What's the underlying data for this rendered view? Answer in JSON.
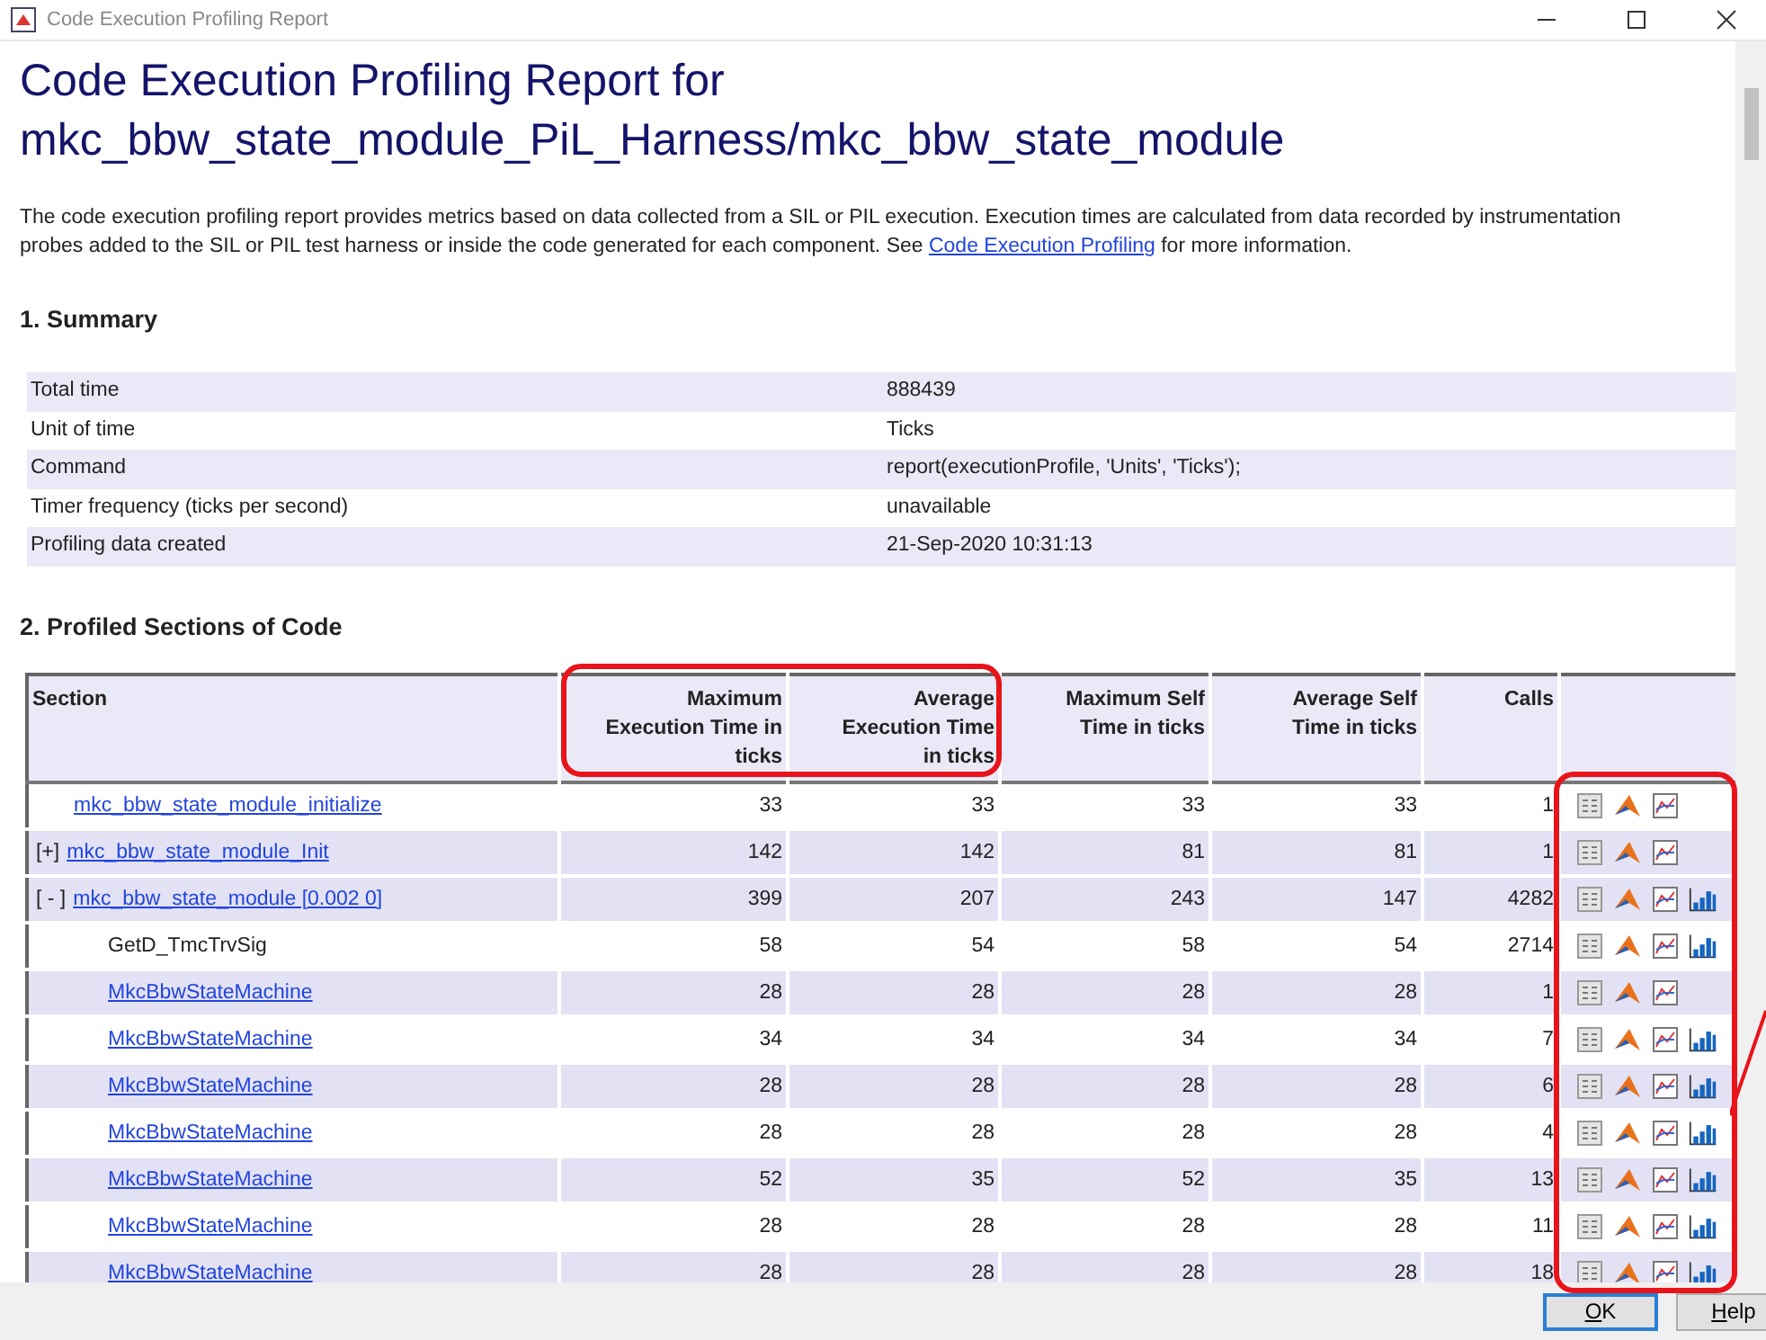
{
  "window": {
    "title": "Code Execution Profiling Report"
  },
  "report": {
    "title_lines": [
      "Code Execution Profiling Report for",
      "mkc_bbw_state_module_PiL_Harness/mkc_bbw_state_module"
    ],
    "intro": "The code execution profiling report provides metrics based on data collected from a SIL or PIL execution. Execution times are calculated from data recorded by instrumentation probes added to the SIL or PIL test harness or inside the code generated for each component. See ",
    "intro_link": "Code Execution Profiling",
    "intro_tail": " for more information."
  },
  "summary": {
    "heading": "1. Summary",
    "rows": [
      {
        "label": "Total time",
        "value": "888439",
        "shaded": true
      },
      {
        "label": "Unit of time",
        "value": "Ticks",
        "shaded": false
      },
      {
        "label": "Command",
        "value": "report(executionProfile, 'Units', 'Ticks');",
        "shaded": true
      },
      {
        "label": "Timer frequency (ticks per second)",
        "value": "unavailable",
        "shaded": false
      },
      {
        "label": "Profiling data created",
        "value": "21-Sep-2020 10:31:13",
        "shaded": true
      }
    ]
  },
  "sections": {
    "heading": "2. Profiled Sections of Code",
    "columns": [
      "Section",
      "Maximum Execution Time in ticks",
      "Average Execution Time in ticks",
      "Maximum Self Time in ticks",
      "Average Self Time in ticks",
      "Calls"
    ],
    "groups": [
      {
        "section": "mkc_bbw_state_module_initialize",
        "link": true,
        "shaded": false,
        "values": [
          "33",
          "33",
          "33",
          "33"
        ],
        "calls": "1",
        "histogram": false
      },
      {
        "expander": "[+]",
        "section": "mkc_bbw_state_module_Init",
        "link": true,
        "shaded": true,
        "values": [
          "142",
          "142",
          "81",
          "81"
        ],
        "calls": "1",
        "histogram": false
      },
      {
        "expander": "[ - ]",
        "section": "mkc_bbw_state_module [0.002 0]",
        "link": true,
        "shaded": true,
        "values": [
          "399",
          "207",
          "243",
          "147"
        ],
        "calls": "4282",
        "histogram": true,
        "children": [
          {
            "section": "GetD_TmcTrvSig",
            "link": false,
            "shaded": false,
            "values": [
              "58",
              "54",
              "58",
              "54"
            ],
            "calls": "2714",
            "histogram": true
          },
          {
            "section": "MkcBbwStateMachine",
            "link": true,
            "shaded": true,
            "values": [
              "28",
              "28",
              "28",
              "28"
            ],
            "calls": "1",
            "histogram": false
          },
          {
            "section": "MkcBbwStateMachine",
            "link": true,
            "shaded": false,
            "values": [
              "34",
              "34",
              "34",
              "34"
            ],
            "calls": "7",
            "histogram": true
          },
          {
            "section": "MkcBbwStateMachine",
            "link": true,
            "shaded": true,
            "values": [
              "28",
              "28",
              "28",
              "28"
            ],
            "calls": "6",
            "histogram": true
          },
          {
            "section": "MkcBbwStateMachine",
            "link": true,
            "shaded": false,
            "values": [
              "28",
              "28",
              "28",
              "28"
            ],
            "calls": "4",
            "histogram": true
          },
          {
            "section": "MkcBbwStateMachine",
            "link": true,
            "shaded": true,
            "values": [
              "52",
              "35",
              "52",
              "35"
            ],
            "calls": "13",
            "histogram": true
          },
          {
            "section": "MkcBbwStateMachine",
            "link": true,
            "shaded": false,
            "values": [
              "28",
              "28",
              "28",
              "28"
            ],
            "calls": "11",
            "histogram": true
          },
          {
            "section": "MkcBbwStateMachine",
            "link": true,
            "shaded": true,
            "values": [
              "28",
              "28",
              "28",
              "28"
            ],
            "calls": "18",
            "histogram": true
          }
        ]
      }
    ]
  },
  "buttons": [
    {
      "label": "OK",
      "default": true
    },
    {
      "label": "Help",
      "default": false
    }
  ]
}
